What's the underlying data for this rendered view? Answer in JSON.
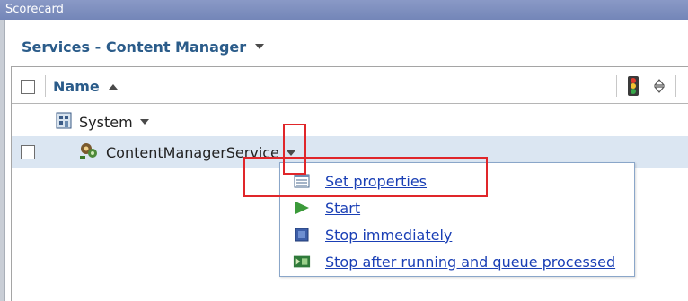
{
  "window": {
    "title": "Scorecard"
  },
  "breadcrumb": {
    "label": "Services - Content Manager"
  },
  "table": {
    "header": {
      "name_label": "Name"
    },
    "rows": [
      {
        "label": "System"
      },
      {
        "label": "ContentManagerService"
      }
    ]
  },
  "context_menu": {
    "items": [
      {
        "label": "Set properties",
        "icon": "properties-icon"
      },
      {
        "label": "Start",
        "icon": "start-icon"
      },
      {
        "label": "Stop immediately",
        "icon": "stop-icon"
      },
      {
        "label": "Stop after running and queue processed",
        "icon": "stop-after-queue-icon"
      }
    ]
  },
  "colors": {
    "link": "#1a3fb5",
    "title_text": "#2b5c8a",
    "selected_row": "#dbe6f2",
    "highlight_box": "#e0262a"
  }
}
